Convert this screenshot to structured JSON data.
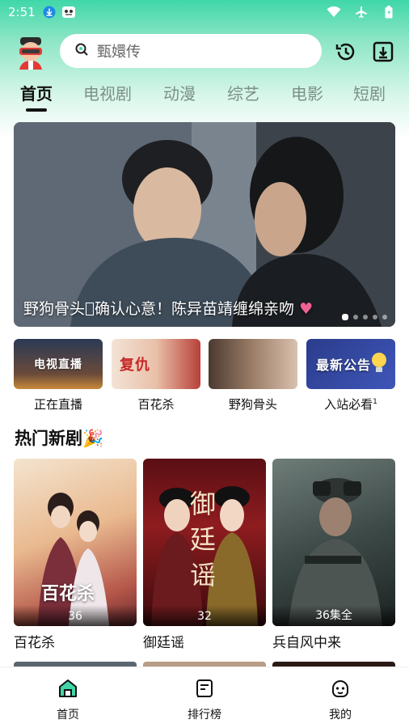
{
  "status_bar": {
    "time": "2:51",
    "icons": [
      "download-status-icon",
      "app-notification-icon",
      "wifi-icon",
      "airplane-icon",
      "battery-icon"
    ]
  },
  "header": {
    "avatar_icon": "vr-character-avatar",
    "search": {
      "placeholder": "甄嬛传",
      "icon": "search-icon"
    },
    "history_icon": "history-icon",
    "download_icon": "download-icon"
  },
  "tabs": [
    {
      "label": "首页",
      "active": true
    },
    {
      "label": "电视剧",
      "active": false
    },
    {
      "label": "动漫",
      "active": false
    },
    {
      "label": "综艺",
      "active": false
    },
    {
      "label": "电影",
      "active": false
    },
    {
      "label": "短剧",
      "active": false
    }
  ],
  "banner": {
    "caption": "野狗骨头",
    "caption_rest": "确认心意！陈异苗靖缠绵亲吻",
    "dots": 5,
    "active_dot": 0
  },
  "quick_entries": [
    {
      "label": "正在直播",
      "thumb_text": "电视直播"
    },
    {
      "label": "百花杀",
      "thumb_text": "复仇"
    },
    {
      "label": "野狗骨头",
      "thumb_text": ""
    },
    {
      "label": "入站必看",
      "thumb_text": "最新公告",
      "superscript": "1"
    }
  ],
  "section": {
    "title": "热门新剧",
    "emoji": "🎉"
  },
  "cards": [
    {
      "title": "百花杀",
      "episodes": "36",
      "poster_text": "百花杀"
    },
    {
      "title": "御廷谣",
      "episodes": "32",
      "poster_text": "御廷谣"
    },
    {
      "title": "兵自风中来",
      "episodes": "36集全",
      "poster_text": ""
    }
  ],
  "bottom_nav": [
    {
      "label": "首页",
      "icon": "home-icon",
      "active": true
    },
    {
      "label": "排行榜",
      "icon": "ranking-icon",
      "active": false
    },
    {
      "label": "我的",
      "icon": "profile-icon",
      "active": false
    }
  ],
  "colors": {
    "accent": "#3fd7a8",
    "text": "#111111",
    "tab_inactive": "#7d8f89"
  }
}
